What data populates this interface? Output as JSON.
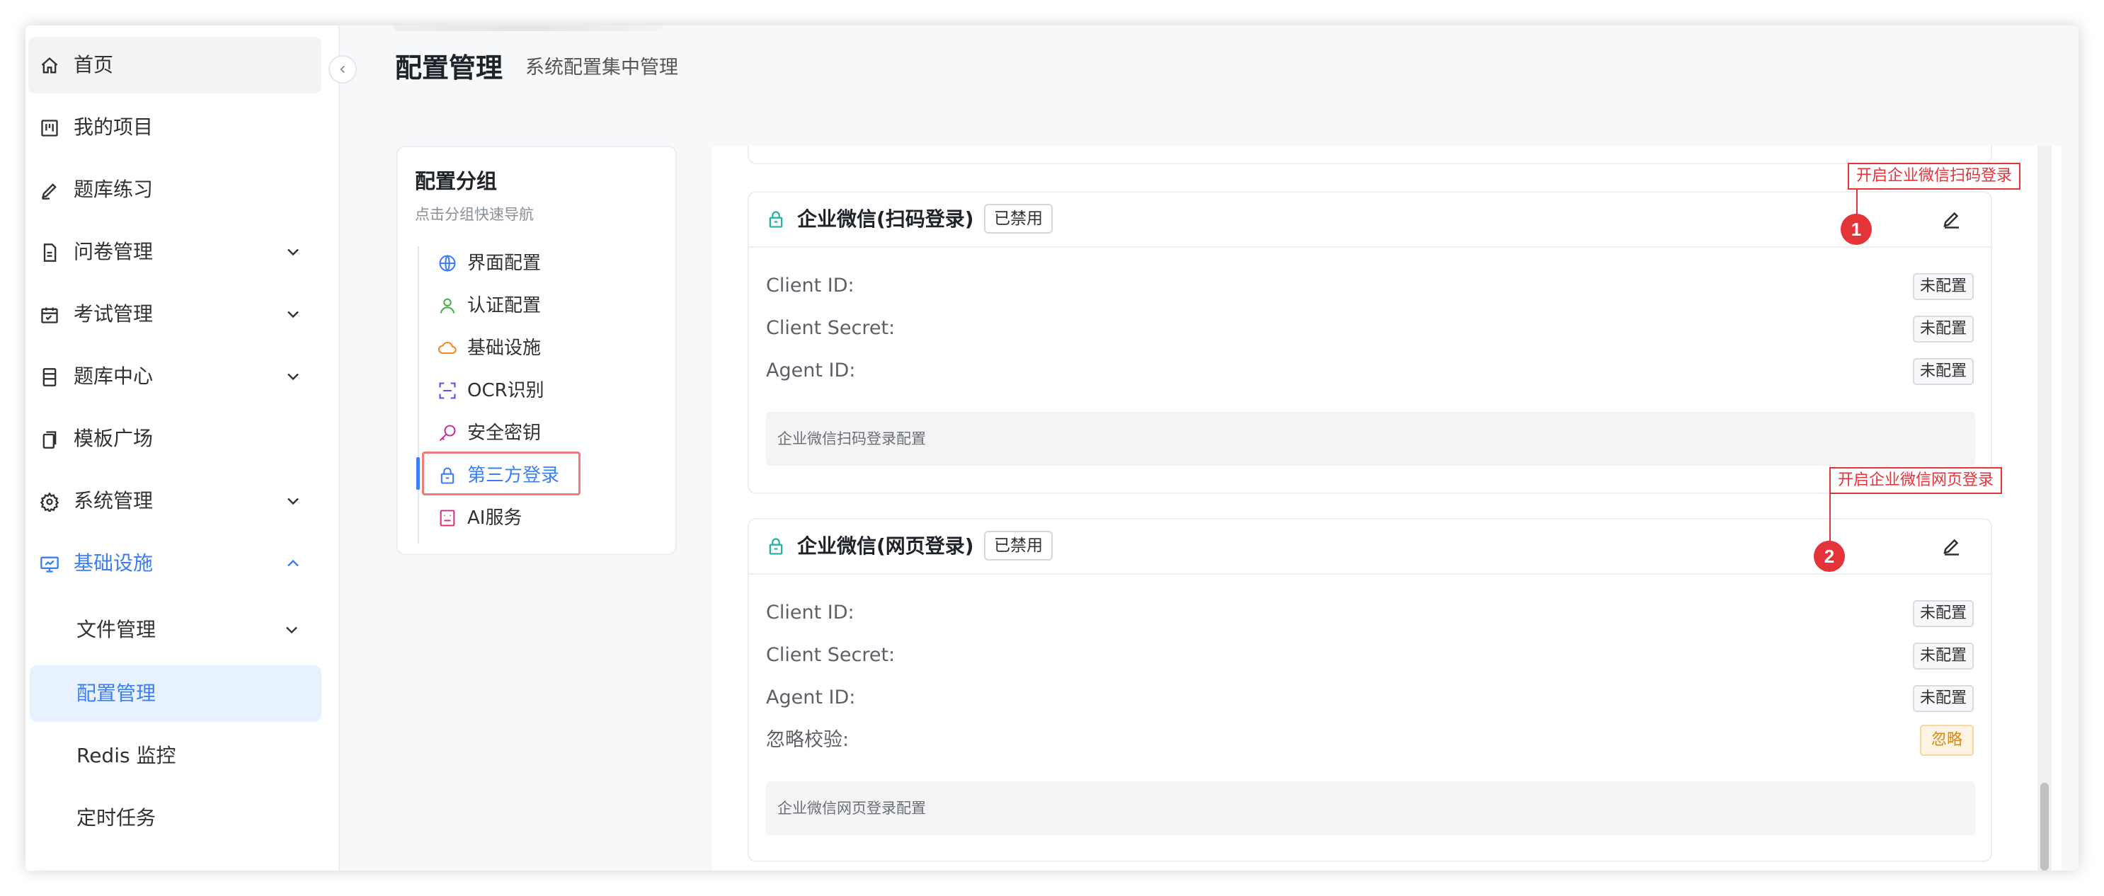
{
  "sidebar": {
    "items": [
      {
        "label": "首页",
        "icon": "home-icon"
      },
      {
        "label": "我的项目",
        "icon": "board-icon"
      },
      {
        "label": "题库练习",
        "icon": "pen-icon"
      },
      {
        "label": "问卷管理",
        "icon": "document-icon"
      },
      {
        "label": "考试管理",
        "icon": "calendar-icon"
      },
      {
        "label": "题库中心",
        "icon": "database-icon"
      },
      {
        "label": "模板广场",
        "icon": "copy-icon"
      },
      {
        "label": "系统管理",
        "icon": "gear-icon"
      },
      {
        "label": "基础设施",
        "icon": "monitor-icon"
      }
    ],
    "sub_items": [
      {
        "label": "文件管理"
      },
      {
        "label": "配置管理"
      },
      {
        "label": "Redis 监控"
      },
      {
        "label": "定时任务"
      }
    ]
  },
  "header": {
    "title": "配置管理",
    "subtitle": "系统配置集中管理"
  },
  "group_panel": {
    "title": "配置分组",
    "hint": "点击分组快速导航",
    "items": [
      {
        "label": "界面配置",
        "icon": "globe-icon",
        "color": "#3b7ef5"
      },
      {
        "label": "认证配置",
        "icon": "user-icon",
        "color": "#4caf50"
      },
      {
        "label": "基础设施",
        "icon": "cloud-icon",
        "color": "#f08c2a"
      },
      {
        "label": "OCR识别",
        "icon": "scan-icon",
        "color": "#5b4fe0"
      },
      {
        "label": "安全密钥",
        "icon": "key-icon",
        "color": "#c0399a"
      },
      {
        "label": "第三方登录",
        "icon": "lock-icon",
        "color": "#3b7ef5"
      },
      {
        "label": "AI服务",
        "icon": "robot-icon",
        "color": "#d63384"
      }
    ]
  },
  "cards": [
    {
      "title": "企业微信(扫码登录)",
      "status": "已禁用",
      "rows": [
        {
          "label": "Client ID:",
          "value": "未配置"
        },
        {
          "label": "Client Secret:",
          "value": "未配置"
        },
        {
          "label": "Agent ID:",
          "value": "未配置"
        }
      ],
      "description": "企业微信扫码登录配置",
      "annotation": {
        "number": "1",
        "text": "开启企业微信扫码登录"
      }
    },
    {
      "title": "企业微信(网页登录)",
      "status": "已禁用",
      "rows": [
        {
          "label": "Client ID:",
          "value": "未配置"
        },
        {
          "label": "Client Secret:",
          "value": "未配置"
        },
        {
          "label": "Agent ID:",
          "value": "未配置"
        },
        {
          "label": "忽略校验:",
          "value": "忽略"
        }
      ],
      "description": "企业微信网页登录配置",
      "annotation": {
        "number": "2",
        "text": "开启企业微信网页登录"
      }
    }
  ],
  "colors": {
    "accent": "#3b7ef5",
    "annotation": "#e5333a",
    "lock_icon": "#2bb3a3",
    "warn": "#d48a1c"
  }
}
